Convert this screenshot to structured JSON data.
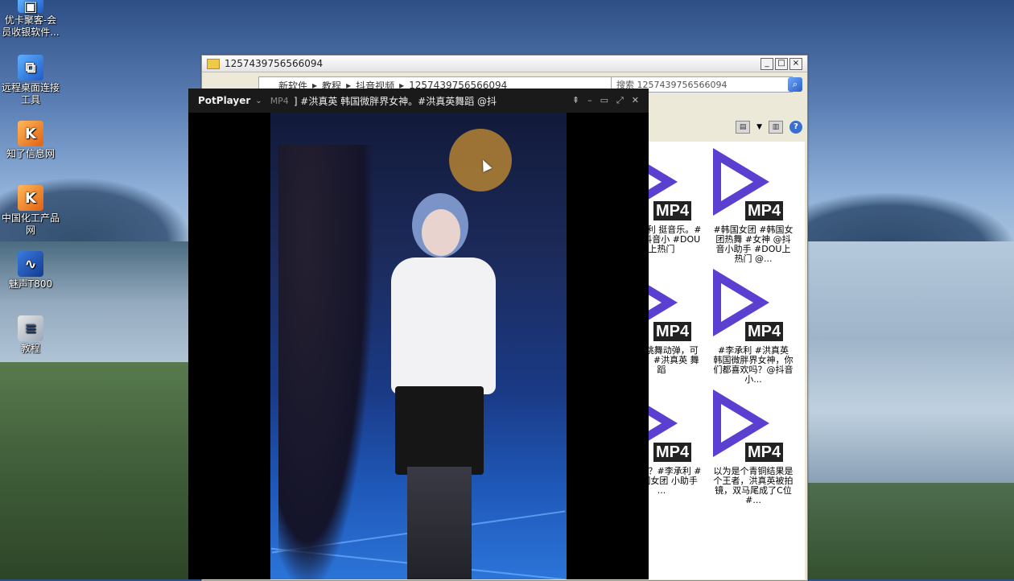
{
  "desktop": {
    "icons": [
      {
        "label": "优卡聚客-会员收银软件...",
        "icon": "app-icon"
      },
      {
        "label": "远程桌面连接工具",
        "icon": "remote-desktop-icon"
      },
      {
        "label": "知了信息网",
        "icon": "k-logo-icon"
      },
      {
        "label": "中国化工产品网",
        "icon": "k-logo-icon"
      },
      {
        "label": "魅声T800",
        "icon": "wave-icon"
      },
      {
        "label": "教程",
        "icon": "document-icon"
      }
    ]
  },
  "explorer": {
    "title": "1257439756566094",
    "breadcrumb": [
      "新软件",
      "教程",
      "抖音视频",
      "1257439756566094"
    ],
    "search_placeholder": "搜索 1257439756566094",
    "files": [
      {
        "name": "#李承利 挺音乐。#韩 @抖音小 #DOU上热门",
        "badge": "MP4"
      },
      {
        "name": "#韩国女团 #韩国女团热舞 #女神 @抖音小助手 #DOU上热门 @...",
        "badge": "MP4"
      },
      {
        "name": "真英 跳舞动弹，可就是 。#洪真英 舞蹈",
        "badge": "MP4"
      },
      {
        "name": "#李承利 #洪真英 韩国微胖界女神，你们都喜欢吗？@抖音小...",
        "badge": "MP4"
      },
      {
        "name": "爱了吗？#李承利 # #韩国女团 小助手 ...",
        "badge": "MP4"
      },
      {
        "name": "以为是个青铜结果是个王者，洪真英被拍镜，双马尾成了C位#...",
        "badge": "MP4"
      }
    ]
  },
  "player": {
    "app_name": "PotPlayer",
    "format_tag": "MP4",
    "title": "] #洪真英 韩国微胖界女神。#洪真英舞蹈 @抖",
    "controls": [
      "pin",
      "minimize",
      "maximize",
      "fullscreen",
      "close"
    ]
  }
}
